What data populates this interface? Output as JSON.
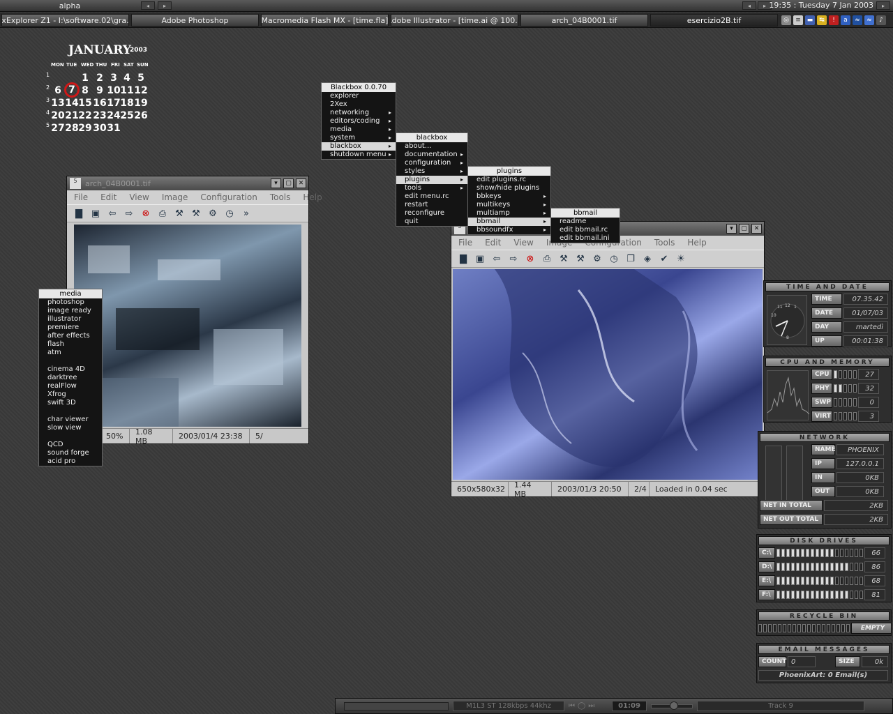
{
  "topbar": {
    "workspace": "alpha",
    "clock": "19:35 : Tuesday 7 Jan 2003"
  },
  "taskbar": [
    "2xExplorer Z1 - I:\\software.02\\gra...",
    "Adobe Photoshop",
    "Macromedia Flash MX - [time.fla]",
    "Adobe Illustrator - [time.ai @ 100...",
    "arch_04B0001.tif",
    "esercizio2B.tif"
  ],
  "calendar": {
    "month": "JANUARY",
    "year": "2003",
    "daynames": [
      "MON",
      "TUE",
      "WED",
      "THU",
      "FRI",
      "SAT",
      "SUN"
    ],
    "weeks": [
      "1",
      "2",
      "3",
      "4",
      "5"
    ],
    "days": [
      [
        "",
        "",
        "1",
        "2",
        "3",
        "4",
        "5"
      ],
      [
        "6",
        "7",
        "8",
        "9",
        "10",
        "11",
        "12"
      ],
      [
        "13",
        "14",
        "15",
        "16",
        "17",
        "18",
        "19"
      ],
      [
        "20",
        "21",
        "22",
        "23",
        "24",
        "25",
        "26"
      ],
      [
        "27",
        "28",
        "29",
        "30",
        "31",
        "",
        ""
      ]
    ],
    "today": "7"
  },
  "window1": {
    "title": "arch_04B0001.tif",
    "menus": [
      "File",
      "Edit",
      "View",
      "Image",
      "Configuration",
      "Tools",
      "Help"
    ],
    "status": [
      "0x32",
      "50%",
      "1.08 MB",
      "2003/01/4 23:38",
      "5/"
    ]
  },
  "window2": {
    "menus": [
      "File",
      "Edit",
      "View",
      "Image",
      "Configuration",
      "Tools",
      "Help"
    ],
    "status": [
      "650x580x32",
      "1.44 MB",
      "2003/01/3 20:50",
      "2/4",
      "Loaded in 0.04 sec"
    ]
  },
  "menu_root": {
    "title": "Blackbox 0.0.70",
    "items": [
      "explorer",
      "2Xex",
      "networking",
      "editors/coding",
      "media",
      "system",
      "blackbox",
      "shutdown menu"
    ]
  },
  "menu_blackbox": {
    "title": "blackbox",
    "items": [
      "about...",
      "documentation",
      "configuration",
      "styles",
      "plugins",
      "tools",
      "edit menu.rc",
      "restart",
      "reconfigure",
      "quit"
    ]
  },
  "menu_plugins": {
    "title": "plugins",
    "items": [
      "edit plugins.rc",
      "show/hide plugins",
      "bbkeys",
      "multikeys",
      "multiamp",
      "bbmail",
      "bbsoundfx"
    ]
  },
  "menu_bbmail": {
    "title": "bbmail",
    "items": [
      "readme",
      "edit bbmail.rc",
      "edit bbmail.ini"
    ]
  },
  "menu_media": {
    "title": "media",
    "items": [
      "photoshop",
      "image ready",
      "illustrator",
      "premiere",
      "after effects",
      "flash",
      "atm",
      "",
      "cinema 4D",
      "darktree",
      "realFlow",
      "Xfrog",
      "swift 3D",
      "",
      "char viewer",
      "slow view",
      "",
      "QCD",
      "sound forge",
      "acid pro"
    ]
  },
  "time_date": {
    "header": "TIME AND DATE",
    "clock_numbers": [
      "12",
      "1",
      "11",
      "10",
      "8"
    ],
    "rows": [
      [
        "TIME",
        "07.35.42"
      ],
      [
        "DATE",
        "01/07/03"
      ],
      [
        "DAY",
        "martedì"
      ],
      [
        "UP",
        "00:01:38"
      ]
    ]
  },
  "cpu_mem": {
    "header": "CPU AND MEMORY",
    "rows": [
      [
        "CPU",
        "27"
      ],
      [
        "PHY",
        "32"
      ],
      [
        "SWP",
        "0"
      ],
      [
        "VIRT",
        "3"
      ]
    ]
  },
  "network": {
    "header": "NETWORK",
    "rows": [
      [
        "NAME",
        "PHOENIX"
      ],
      [
        "IP",
        "127.0.0.1"
      ],
      [
        "IN",
        "0KB"
      ],
      [
        "OUT",
        "0KB"
      ]
    ],
    "totals": [
      [
        "NET IN TOTAL",
        "2KB"
      ],
      [
        "NET OUT TOTAL",
        "2KB"
      ]
    ]
  },
  "disks": {
    "header": "DISK DRIVES",
    "rows": [
      [
        "C:\\",
        "66"
      ],
      [
        "D:\\",
        "86"
      ],
      [
        "E:\\",
        "68"
      ],
      [
        "F:\\",
        "81"
      ]
    ]
  },
  "recycle": {
    "header": "RECYCLE BIN",
    "status": "EMPTY"
  },
  "email": {
    "header": "EMAIL MESSAGES",
    "count_label": "COUNT",
    "count": "0",
    "size_label": "SIZE",
    "size": "0k",
    "footer": "PhoenixArt: 0 Email(s)"
  },
  "player": {
    "info": "M1L3 ST 128kbps 44khz",
    "time": "01:09",
    "track": "Track 9"
  },
  "colors": {
    "desktop": "#3a3a3a",
    "today_circle": "#d01818",
    "menu_bg": "#141414"
  }
}
